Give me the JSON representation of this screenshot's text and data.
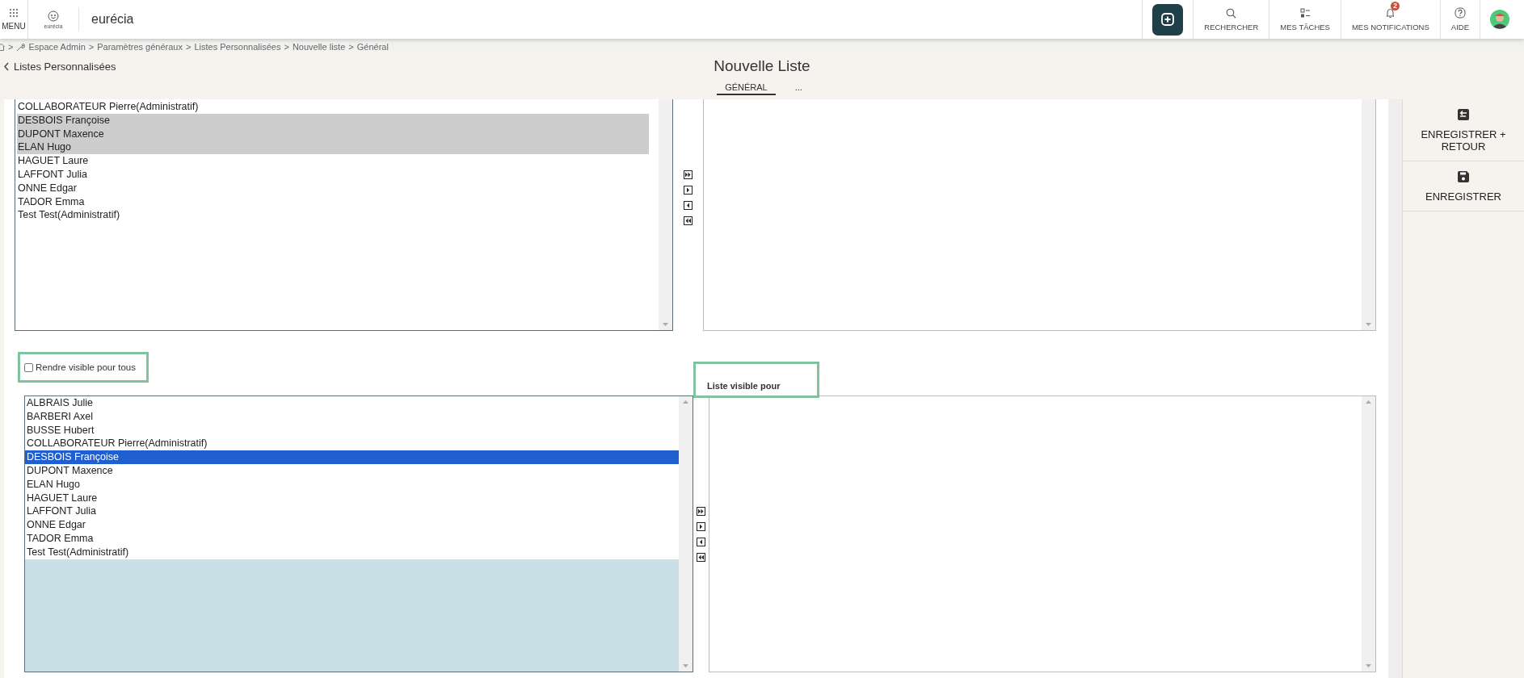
{
  "header": {
    "menu_label": "MENU",
    "logo_caption": "eurécia",
    "brand": "eurécia",
    "actions": [
      {
        "kind": "add"
      },
      {
        "kind": "search",
        "label": "RECHERCHER"
      },
      {
        "kind": "tasks",
        "label": "MES TÂCHES"
      },
      {
        "kind": "notifications",
        "label": "MES NOTIFICATIONS",
        "badge": "2"
      },
      {
        "kind": "help",
        "label": "AIDE"
      },
      {
        "kind": "avatar"
      }
    ]
  },
  "breadcrumb": {
    "separator": ">",
    "items": [
      "Espace Admin",
      "Paramètres généraux",
      "Listes Personnalisées",
      "Nouvelle liste",
      "Général"
    ]
  },
  "back_link": "Listes Personnalisées",
  "title": "Nouvelle Liste",
  "tabs": [
    {
      "label": "GÉNÉRAL",
      "selected": true
    },
    {
      "label": "...",
      "selected": false
    }
  ],
  "members_picker": {
    "available": [
      {
        "name": "COLLABORATEUR Pierre(Administratif)",
        "selected": false
      },
      {
        "name": "DESBOIS Françoise",
        "selected": true
      },
      {
        "name": "DUPONT Maxence",
        "selected": true
      },
      {
        "name": "ELAN Hugo",
        "selected": true
      },
      {
        "name": "HAGUET Laure",
        "selected": false
      },
      {
        "name": "LAFFONT Julia",
        "selected": false
      },
      {
        "name": "ONNE Edgar",
        "selected": false
      },
      {
        "name": "TADOR Emma",
        "selected": false
      },
      {
        "name": "Test Test(Administratif)",
        "selected": false
      }
    ]
  },
  "visibility": {
    "checkbox": {
      "label": "Rendre visible pour tous",
      "checked": false
    },
    "chosen_label": "Liste visible pour",
    "available": [
      {
        "name": "ALBRAIS Julie",
        "selected": false
      },
      {
        "name": "BARBERI Axel",
        "selected": false
      },
      {
        "name": "BUSSE Hubert",
        "selected": false
      },
      {
        "name": "COLLABORATEUR Pierre(Administratif)",
        "selected": false
      },
      {
        "name": "DESBOIS Françoise",
        "selected": true
      },
      {
        "name": "DUPONT Maxence",
        "selected": false
      },
      {
        "name": "ELAN Hugo",
        "selected": false
      },
      {
        "name": "HAGUET Laure",
        "selected": false
      },
      {
        "name": "LAFFONT Julia",
        "selected": false
      },
      {
        "name": "ONNE Edgar",
        "selected": false
      },
      {
        "name": "TADOR Emma",
        "selected": false
      },
      {
        "name": "Test Test(Administratif)",
        "selected": false
      }
    ]
  },
  "sidebar": {
    "buttons": [
      {
        "kind": "save-return",
        "label": "ENREGISTRER + RETOUR"
      },
      {
        "kind": "save",
        "label": "ENREGISTRER"
      }
    ]
  }
}
